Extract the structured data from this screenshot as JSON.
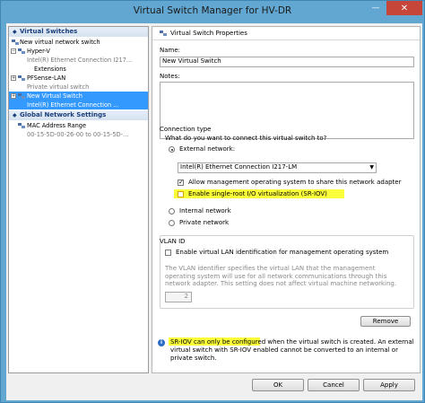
{
  "window": {
    "title": "Virtual Switch Manager for HV-DR",
    "minimize_glyph": "—",
    "close_glyph": "✕"
  },
  "tree": {
    "virtual_switches_header": "Virtual Switches",
    "new_virtual_network_switch": "New virtual network switch",
    "hyperv": {
      "name": "Hyper-V",
      "adapter": "Intel(R) Ethernet Connection I217...",
      "extensions": "Extensions"
    },
    "pfsense": {
      "name": "PFSense-LAN",
      "type": "Private virtual switch"
    },
    "new_switch": {
      "name": "New Virtual Switch",
      "adapter": "Intel(R) Ethernet Connection ..."
    },
    "global_header": "Global Network Settings",
    "mac": {
      "name": "MAC Address Range",
      "range": "00-15-5D-00-26-00 to 00-15-5D-..."
    }
  },
  "props": {
    "header": "Virtual Switch Properties",
    "name_label": "Name:",
    "name_value": "New Virtual Switch",
    "notes_label": "Notes:",
    "connection_type_label": "Connection type",
    "connection_question": "What do you want to connect this virtual switch to?",
    "external_network": "External network:",
    "adapter_selected": "Intel(R) Ethernet Connection I217-LM",
    "allow_management": "Allow management operating system to share this network adapter",
    "enable_sriov": "Enable single-root I/O virtualization (SR-IOV)",
    "internal_network": "Internal network",
    "private_network": "Private network",
    "vlan_id_label": "VLAN ID",
    "enable_vlan": "Enable virtual LAN identification for management operating system",
    "vlan_desc": "The VLAN identifier specifies the virtual LAN that the management operating system will use for all network communications through this network adapter. This setting does not affect virtual machine networking.",
    "vlan_value": "2",
    "remove": "Remove",
    "info_text": "SR-IOV can only be configured when the virtual switch is created. An external virtual switch with SR-IOV enabled cannot be converted to an internal or private switch."
  },
  "buttons": {
    "ok": "OK",
    "cancel": "Cancel",
    "apply": "Apply"
  },
  "colors": {
    "selection": "#3399ff",
    "highlight": "#fbff3a",
    "close": "#c7463a",
    "frame": "#62a7d1"
  }
}
